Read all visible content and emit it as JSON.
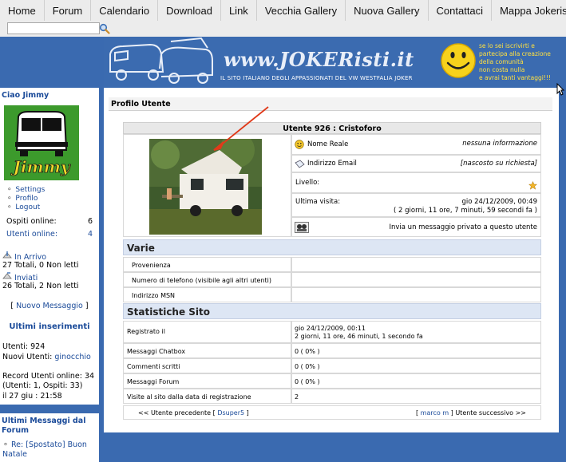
{
  "nav": {
    "items": [
      "Home",
      "Forum",
      "Calendario",
      "Download",
      "Link",
      "Vecchia Gallery",
      "Nuova Gallery",
      "Contattaci",
      "Mappa Jokeristi"
    ]
  },
  "search": {
    "value": ""
  },
  "banner": {
    "site_title": "www.JOKERisti.it",
    "subtitle": "IL SITO ITALIANO DEGLI APPASSIONATI DEL VW WESTFALIA JOKER",
    "promo_lines": [
      "se lo sei iscrivirti e",
      "partecipa alla creazione",
      "della comunità",
      "non costa nulla",
      "e avrai tanti vantaggi!!!"
    ]
  },
  "sidebar": {
    "greeting": "Ciao Jimmy",
    "avatar_caption": "Jimmy",
    "links": [
      "Settings",
      "Profilo",
      "Logout"
    ],
    "guests_label": "Ospiti online:",
    "guests_value": "6",
    "users_label": "Utenti online:",
    "users_value": "4",
    "inbox_label": "In Arrivo",
    "inbox_stats": "27 Totali, 0 Non letti",
    "sent_label": "Inviati",
    "sent_stats": "26 Totali, 2 Non letti",
    "new_message": "[ Nuovo Messaggio ]",
    "new_message_link": "Nuovo Messaggio",
    "latest_heading": "Ultimi inserimenti",
    "users_count": "Utenti: 924",
    "new_users_label": "Nuovi Utenti:",
    "new_users_value": "ginocchio",
    "record_line1": "Record Utenti online: 34",
    "record_line2": "(Utenti: 1, Ospiti: 33)",
    "record_line3": "il 27 giu : 21:58",
    "forum_heading": "Ultimi Messaggi dal Forum",
    "forum_item": "Re: [Spostato] Buon Natale"
  },
  "profile": {
    "panel_title": "Profilo Utente",
    "user_heading": "Utente 926 : Cristoforo",
    "rows": {
      "real_name_label": "Nome Reale",
      "real_name_value": "nessuna informazione",
      "email_label": "Indirizzo Email",
      "email_value": "[nascosto su richiesta]",
      "level_label": "Livello:",
      "last_visit_label": "Ultima visita:",
      "last_visit_date": "gio 24/12/2009, 00:49",
      "last_visit_ago": "( 2 giorni, 11 ore, 7 minuti, 59 secondi fa )",
      "pm_text": "Invia un messaggio privato a questo utente"
    },
    "varie": {
      "heading": "Varie",
      "fields": [
        "Provenienza",
        "Numero di telefono (visibile agli altri utenti)",
        "Indirizzo MSN"
      ]
    },
    "stats": {
      "heading": "Statistiche Sito",
      "registered_label": "Registrato il",
      "registered_value": "gio 24/12/2009, 00:11",
      "registered_ago": "2 giorni, 11 ore, 46 minuti, 1 secondo fa",
      "rows": [
        {
          "label": "Messaggi Chatbox",
          "value": "0 ( 0% )"
        },
        {
          "label": "Commenti scritti",
          "value": "0 ( 0% )"
        },
        {
          "label": "Messaggi Forum",
          "value": "0 ( 0% )"
        },
        {
          "label": "Visite al sito dalla data di registrazione",
          "value": "2"
        }
      ]
    },
    "pager": {
      "prev_text": "<< Utente precedente [",
      "prev_user": "Dsuper5",
      "prev_close": "]",
      "next_open": "[",
      "next_user": "marco m",
      "next_text": "] Utente successivo >>"
    }
  },
  "colors": {
    "page_bg": "#3a6ab0",
    "link": "#1a4a99",
    "section_bg": "#dde6f4",
    "avatar_bg": "#3c9a2c"
  }
}
